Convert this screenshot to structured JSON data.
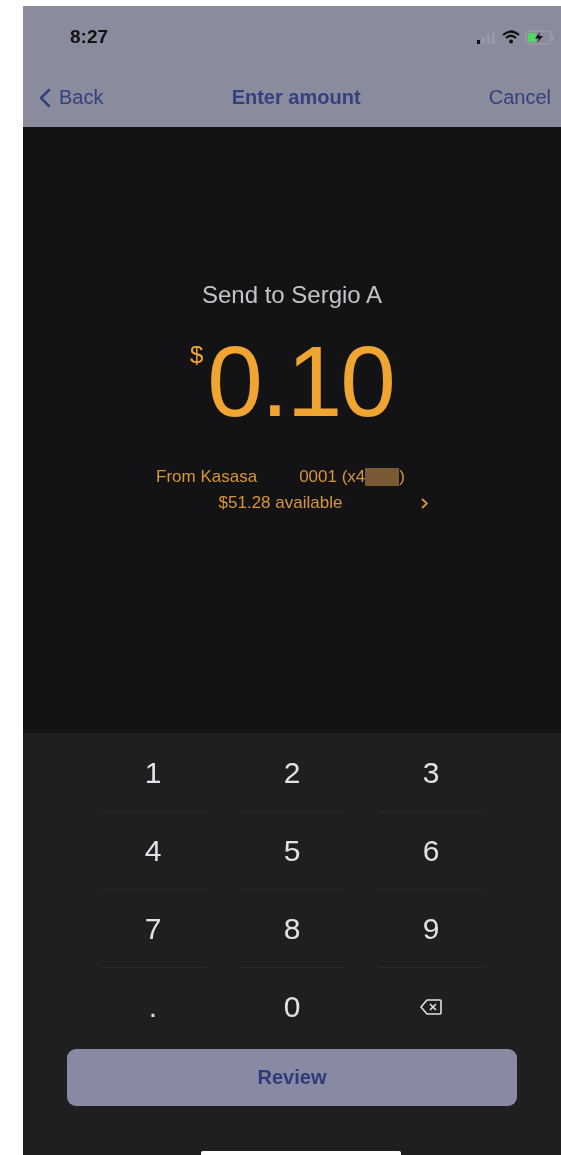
{
  "status_bar": {
    "time": "8:27"
  },
  "nav": {
    "back": "Back",
    "title": "Enter amount",
    "cancel": "Cancel"
  },
  "recipient": "Send to Sergio A",
  "amount": {
    "currency": "$",
    "value": "0.10"
  },
  "source": {
    "from": "From Kasasa",
    "account_start": "0001 (x4",
    "account_end": ")",
    "available": "$51.28 available"
  },
  "keypad": [
    {
      "kind": "digit",
      "label": "1"
    },
    {
      "kind": "digit",
      "label": "2"
    },
    {
      "kind": "digit",
      "label": "3"
    },
    {
      "kind": "digit",
      "label": "4"
    },
    {
      "kind": "digit",
      "label": "5"
    },
    {
      "kind": "digit",
      "label": "6"
    },
    {
      "kind": "digit",
      "label": "7"
    },
    {
      "kind": "digit",
      "label": "8"
    },
    {
      "kind": "digit",
      "label": "9"
    },
    {
      "kind": "digit",
      "label": "."
    },
    {
      "kind": "digit",
      "label": "0"
    },
    {
      "kind": "backspace"
    }
  ],
  "review_button": "Review"
}
